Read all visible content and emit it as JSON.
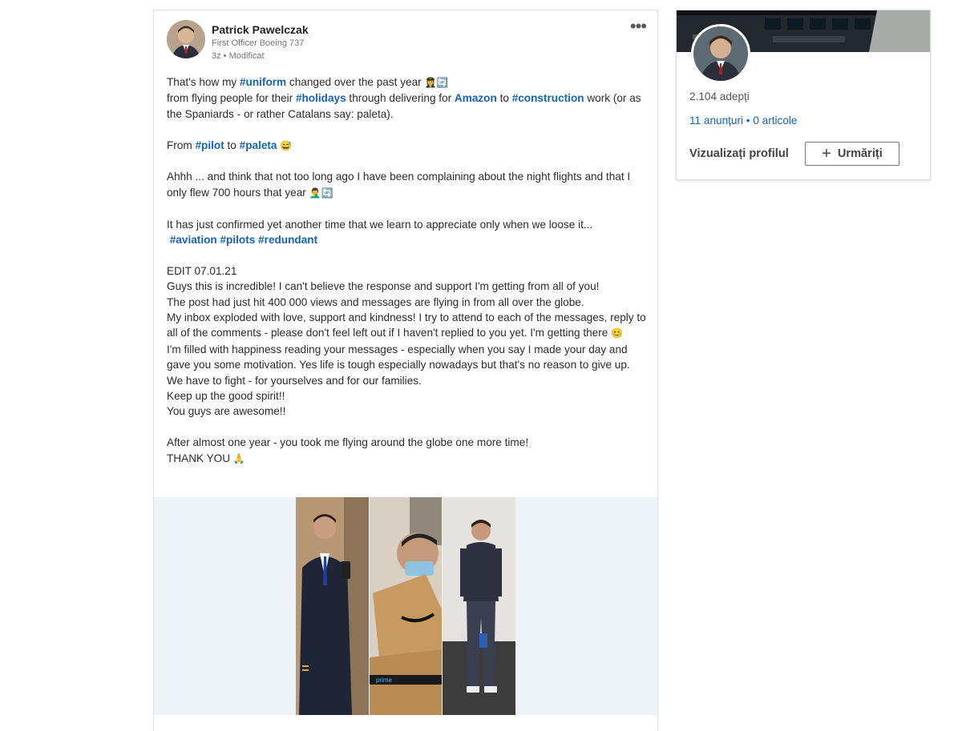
{
  "post": {
    "author_name": "Patrick Pawelczak",
    "author_subtitle": "First Officer Boeing 737",
    "time": "3z • Modificat",
    "more_icon": "•••",
    "line1_a": "That's how my ",
    "tag_uniform": "#uniform",
    "line1_b": " changed over the past year ",
    "emoji_1": "👩‍✈️🔄",
    "line2_a": "from flying people for their ",
    "tag_holidays": "#holidays",
    "line2_b": " through delivering for ",
    "mention_amazon": "Amazon",
    "line2_c": " to ",
    "tag_construction": "#construction",
    "line2_d": " work (or as the Spaniards - or rather Catalans say: paleta).",
    "line3_a": "From ",
    "tag_pilot": "#pilot",
    "line3_b": " to ",
    "tag_paleta": "#paleta",
    "emoji_2": "😅",
    "line4": "Ahhh ... and think that not too long ago I have been complaining about the night flights and that I only flew 700 hours that year ",
    "emoji_3": "🤦‍♂️🔄",
    "line5": "It has just confirmed yet another time that we learn to appreciate only when we loose it...",
    "tag_aviation": "#aviation",
    "tag_pilots": "#pilots",
    "tag_redundant": "#redundant",
    "edit_1": "EDIT 07.01.21",
    "edit_2": "Guys this is incredible! I can't believe the response and support I'm getting from all of you!",
    "edit_3": "The post had just hit 400 000 views and messages are flying in from all over the globe.",
    "edit_4": "My inbox exploded with love, support and kindness! I try to attend to each of the messages, reply to all of the comments - please don't feel left out if I haven't replied to you yet. I'm getting there ",
    "emoji_4": "😊",
    "edit_5": "I'm filled with happiness reading your messages - especially when you say I made your day and gave you some motivation. Yes life is tough especially nowadays but that's no reason to give up. We have to fight - for yourselves and for our families.",
    "edit_6": "Keep up the good spirit!!",
    "edit_7": "You guys are awesome!!",
    "closing_1": "After almost one year - you took me flying around the globe one more time!",
    "closing_2": "THANK YOU ",
    "emoji_5": "🙏"
  },
  "profile_card": {
    "followers": "2.104 adepți",
    "stats": "11 anunțuri • 0 articole",
    "view_profile": "Vizualizați profilul",
    "follow_label": "Urmăriți",
    "follow_icon": "+"
  },
  "colors": {
    "link": "#1563c0",
    "text": "#2b2b2b",
    "muted": "#777777"
  }
}
